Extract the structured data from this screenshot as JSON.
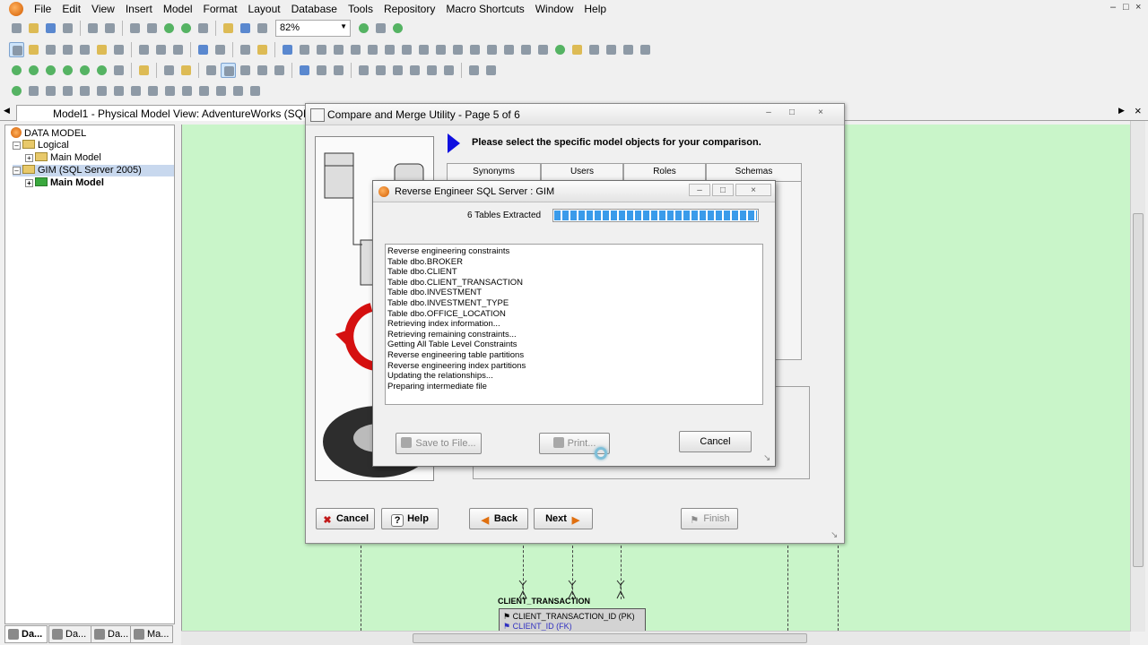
{
  "menubar": {
    "items": [
      "File",
      "Edit",
      "View",
      "Insert",
      "Model",
      "Format",
      "Layout",
      "Database",
      "Tools",
      "Repository",
      "Macro Shortcuts",
      "Window",
      "Help"
    ]
  },
  "toolbar": {
    "zoom_value": "82%"
  },
  "tab": {
    "title": "Model1 - Physical Model View: AdventureWorks (SQL Server"
  },
  "tree": {
    "root": "DATA MODEL",
    "logical": "Logical",
    "main_model_logical": "Main Model",
    "physical": "GIM (SQL Server 2005)",
    "main_model_physical": "Main Model"
  },
  "bottom_tabs": [
    "Da...",
    "Da...",
    "Da...",
    "Ma..."
  ],
  "entity": {
    "title": "CLIENT_TRANSACTION",
    "columns": [
      "CLIENT_TRANSACTION_ID (PK)",
      "CLIENT_ID (FK)"
    ]
  },
  "compare_dialog": {
    "title": "Compare and Merge Utility - Page 5 of 6",
    "prompt": "Please select the specific model objects for your comparison.",
    "tabs": [
      "Synonyms",
      "Users",
      "Roles",
      "Schemas"
    ],
    "cancel_label": "Cancel",
    "help_label": "Help",
    "back_label": "Back",
    "next_label": "Next",
    "finish_label": "Finish"
  },
  "reverse_dialog": {
    "title": "Reverse Engineer SQL Server : GIM",
    "status": "6 Tables Extracted",
    "progress": 1.0,
    "log": [
      "Reverse engineering constraints",
      "Table dbo.BROKER",
      "Table dbo.CLIENT",
      "Table dbo.CLIENT_TRANSACTION",
      "Table dbo.INVESTMENT",
      "Table dbo.INVESTMENT_TYPE",
      "Table dbo.OFFICE_LOCATION",
      "Retrieving index information...",
      "Retrieving remaining constraints...",
      "Getting All Table Level Constraints",
      "Reverse engineering table partitions",
      "Reverse engineering index partitions",
      "Updating the relationships...",
      "Preparing intermediate file"
    ],
    "save_label": "Save to File...",
    "print_label": "Print...",
    "cancel_label": "Cancel"
  },
  "colors": {
    "canvas": "#c9f5c9",
    "progress": "#3a9bea",
    "arrow": "#1010e0"
  }
}
